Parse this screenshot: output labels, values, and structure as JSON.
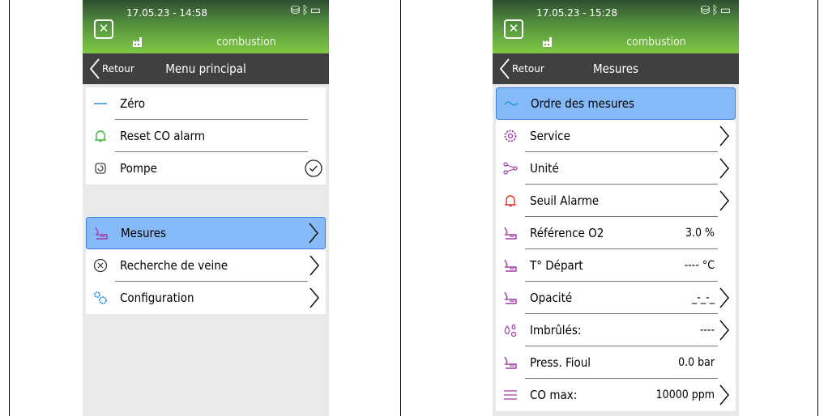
{
  "left": {
    "datetime": "17.05.23 - 14:58",
    "header_title": "combustion",
    "back_label": "Retour",
    "nav_title": "Menu principal",
    "group1": [
      {
        "label": "Zéro",
        "icon": "dash-icon"
      },
      {
        "label": "Reset CO alarm",
        "icon": "bell-icon"
      },
      {
        "label": "Pompe",
        "icon": "pump-icon",
        "trailing": "check-circle-icon"
      }
    ],
    "group2": [
      {
        "label": "Mesures",
        "icon": "measure-icon",
        "selected": true
      },
      {
        "label": "Recherche de veine",
        "icon": "circle-x-icon"
      },
      {
        "label": "Configuration",
        "icon": "gears-icon"
      }
    ]
  },
  "right": {
    "datetime": "17.05.23 - 15:28",
    "header_title": "combustion",
    "back_label": "Retour",
    "nav_title": "Mesures",
    "items": [
      {
        "label": "Ordre des mesures",
        "icon": "swap-icon",
        "selected": true
      },
      {
        "label": "Service",
        "icon": "gear-icon",
        "chevron": true
      },
      {
        "label": "Unité",
        "icon": "share-icon",
        "chevron": true
      },
      {
        "label": "Seuil Alarme",
        "icon": "bell-icon",
        "chevron": true
      },
      {
        "label": "Référence O2",
        "icon": "measure-icon",
        "value": "3.0 %"
      },
      {
        "label": "T° Départ",
        "icon": "measure-icon",
        "value": "---- °C"
      },
      {
        "label": "Opacité",
        "icon": "measure-icon",
        "value": "_-_-_",
        "chevron": true
      },
      {
        "label": "Imbrûlés:",
        "icon": "drops-icon",
        "value": "----",
        "chevron": true
      },
      {
        "label": "Press. Fioul",
        "icon": "measure-icon",
        "value": "0.0 bar"
      },
      {
        "label": "CO max:",
        "icon": "list-icon",
        "value": "10000 ppm",
        "chevron": true
      }
    ]
  },
  "colors": {
    "header_gradient_top": "#2f4f32",
    "header_gradient_bottom": "#7fca45",
    "navbar": "#404040",
    "selection": "#86b9f7",
    "icon_green": "#38b838",
    "icon_purple": "#a23ca8",
    "icon_red": "#e03030",
    "icon_blue": "#2a90e0"
  }
}
